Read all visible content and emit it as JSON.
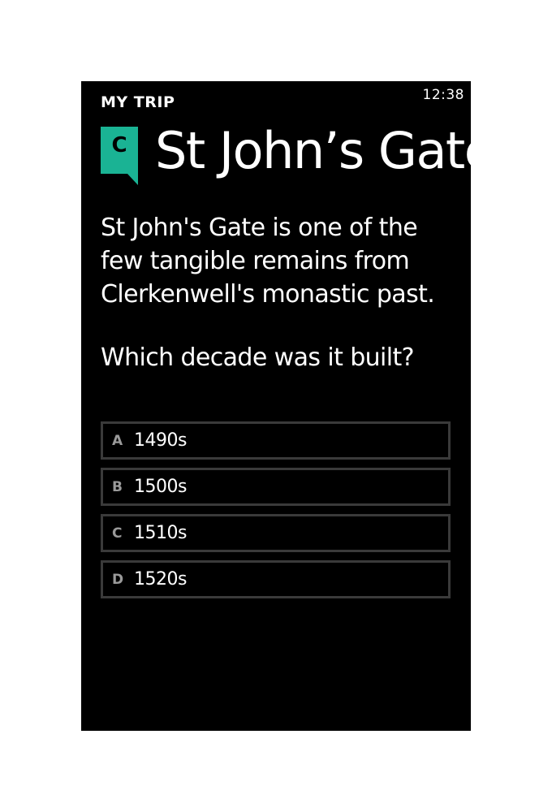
{
  "status_bar": {
    "time": "12:38"
  },
  "header": {
    "app_title": "MY TRIP",
    "stop_letter": "C",
    "page_title": "St John’s Gate",
    "accent_color": "#1ab394"
  },
  "quiz": {
    "description": "St John's Gate is one of the few tangible remains from Clerkenwell's monastic past.",
    "question": "Which decade was it built?",
    "answers": [
      {
        "letter": "A",
        "text": "1490s"
      },
      {
        "letter": "B",
        "text": "1500s"
      },
      {
        "letter": "C",
        "text": "1510s"
      },
      {
        "letter": "D",
        "text": "1520s"
      }
    ]
  }
}
